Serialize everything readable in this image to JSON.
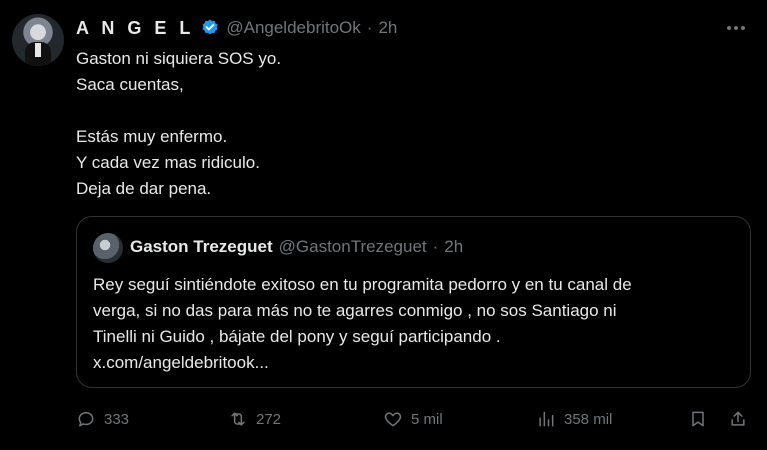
{
  "tweet": {
    "author_name": "A N G E L",
    "handle": "@AngeldebritoOk",
    "separator": "·",
    "time": "2h",
    "lines": [
      "Gaston ni siquiera SOS yo.",
      "Saca cuentas,",
      "",
      "Estás muy enfermo.",
      "Y cada vez mas ridiculo.",
      "Deja de dar pena."
    ]
  },
  "quote": {
    "author_name": "Gaston Trezeguet",
    "handle": "@GastonTrezeguet",
    "separator": "·",
    "time": "2h",
    "lines": [
      "Rey seguí sintiéndote exitoso en tu programita pedorro y en tu canal de",
      "verga, si no das para más no te agarres conmigo , no sos Santiago ni",
      "Tinelli ni Guido , bájate del pony y seguí participando .",
      "x.com/angeldebritook..."
    ]
  },
  "actions": {
    "replies": "333",
    "reposts": "272",
    "likes": "5 mil",
    "views": "358 mil"
  },
  "icons": {
    "verified": "verified-badge-icon",
    "more": "more-icon",
    "reply": "reply-icon",
    "repost": "repost-icon",
    "like": "like-icon",
    "views": "views-icon",
    "bookmark": "bookmark-icon",
    "share": "share-icon"
  },
  "colors": {
    "background": "#000000",
    "text": "#e7e9ea",
    "muted": "#71767b",
    "verified": "#1d9bf0",
    "border": "#2f3336"
  }
}
